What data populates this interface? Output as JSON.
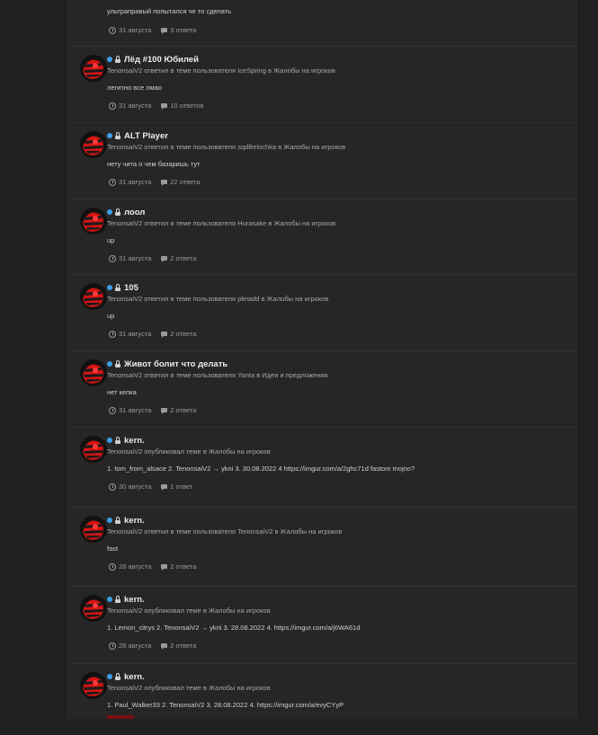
{
  "feed": [
    {
      "title": "",
      "meta": "",
      "body": "ультраправый попытался че то сделать",
      "date": "31 августа",
      "replies": "3 ответа",
      "partial": true
    },
    {
      "title": "Лёд #100 Юбилей",
      "meta": "TenonsaiV2 ответил в теме пользователя IceSpring в Жалобы на игроков",
      "body": "легитно все лмао",
      "date": "31 августа",
      "replies": "10 ответов"
    },
    {
      "title": "ALT Player",
      "meta": "TenonsaiV2 ответил в теме пользователя sqdBelochka в Жалобы на игроков",
      "body": "нету чита о чем базаришь тут",
      "date": "31 августа",
      "replies": "22 ответа"
    },
    {
      "title": "лоол",
      "meta": "TenonsaiV2 ответил в теме пользователя Hurasake в Жалобы на игроков",
      "body": "up",
      "date": "31 августа",
      "replies": "2 ответа"
    },
    {
      "title": "105",
      "meta": "TenonsaiV2 ответил в теме пользователя pleiadd в Жалобы на игроков",
      "body": "up",
      "date": "31 августа",
      "replies": "2 ответа"
    },
    {
      "title": "Живот болит что делать",
      "meta": "TenonsaiV2 ответил в теме пользователя Yonta в Идеи и предложения",
      "body": "нет кепка",
      "date": "31 августа",
      "replies": "2 ответа"
    },
    {
      "title": "kern.",
      "meta": "TenonsaiV2 опубликовал теме в Жалобы на игроков",
      "body": "1. tom_from_alsace 2. TenonsaiV2 → ykni 3. 30.08.2022 4 https://imgur.com/a/2ghc71d fastom mojno?",
      "date": "30 августа",
      "replies": "1 ответ"
    },
    {
      "title": "kern.",
      "meta": "TenonsaiV2 ответил в теме пользователя TenonsaiV2 в Жалобы на игроков",
      "body": "fast",
      "date": "28 августа",
      "replies": "2 ответа"
    },
    {
      "title": "kern.",
      "meta": "TenonsaiV2 опубликовал теме в Жалобы на игроков",
      "body": "1. Lemon_citrys 2. TenonsaiV2 → ykni 3. 28.08.2022 4. https://imgur.com/a/j6WA61d",
      "date": "28 августа",
      "replies": "2 ответа"
    },
    {
      "title": "kern.",
      "meta": "TenonsaiV2 опубликовал теме в Жалобы на игроков",
      "body": "1. Paul_Walker33 2. TenonsaiV2 3. 28.08.2022 4. https://imgur.com/a/evyCYyP",
      "date": "",
      "replies": "",
      "partial_bottom": true
    }
  ],
  "colors": {
    "background": "#202020",
    "panel": "#262626",
    "online": "#3d9fe6",
    "avatar_red": "#d41414"
  },
  "icons": {
    "online": "online-dot-icon",
    "lock": "lock-icon",
    "date": "clock-icon",
    "replies": "comment-icon",
    "avatar": "avatar-icon"
  }
}
